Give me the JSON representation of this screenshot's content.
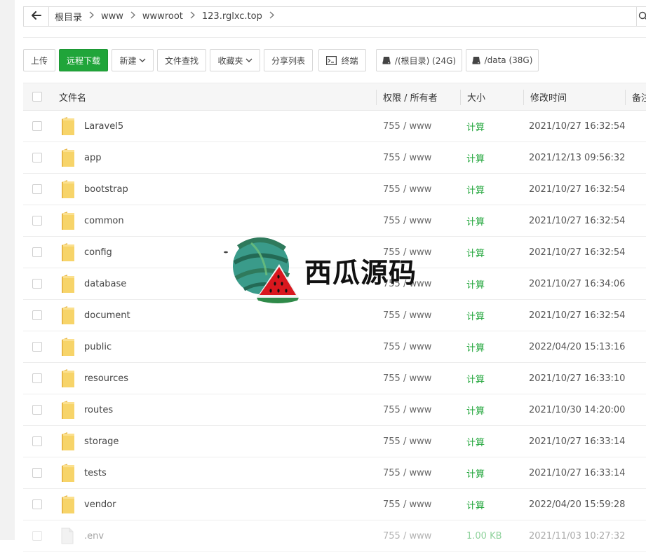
{
  "breadcrumb": {
    "items": [
      "根目录",
      "www",
      "wwwroot",
      "123.rglxc.top"
    ]
  },
  "toolbar": {
    "upload": "上传",
    "remote_download": "远程下载",
    "new": "新建",
    "file_search": "文件查找",
    "favorites": "收藏夹",
    "share_list": "分享列表",
    "terminal": "终端",
    "disk_root": "/(根目录) (24G)",
    "disk_data": "/data (38G)"
  },
  "table": {
    "headers": {
      "name": "文件名",
      "perm": "权限 / 所有者",
      "size": "大小",
      "mtime": "修改时间",
      "note": "备注"
    },
    "rows": [
      {
        "name": "Laravel5",
        "perm": "755 / www",
        "size": "计算",
        "mtime": "2021/10/27 16:32:54",
        "type": "folder"
      },
      {
        "name": "app",
        "perm": "755 / www",
        "size": "计算",
        "mtime": "2021/12/13 09:56:32",
        "type": "folder"
      },
      {
        "name": "bootstrap",
        "perm": "755 / www",
        "size": "计算",
        "mtime": "2021/10/27 16:32:54",
        "type": "folder"
      },
      {
        "name": "common",
        "perm": "755 / www",
        "size": "计算",
        "mtime": "2021/10/27 16:32:54",
        "type": "folder"
      },
      {
        "name": "config",
        "perm": "755 / www",
        "size": "计算",
        "mtime": "2021/10/27 16:32:54",
        "type": "folder"
      },
      {
        "name": "database",
        "perm": "755 / www",
        "size": "计算",
        "mtime": "2021/10/27 16:34:06",
        "type": "folder"
      },
      {
        "name": "document",
        "perm": "755 / www",
        "size": "计算",
        "mtime": "2021/10/27 16:32:54",
        "type": "folder"
      },
      {
        "name": "public",
        "perm": "755 / www",
        "size": "计算",
        "mtime": "2022/04/20 15:13:16",
        "type": "folder"
      },
      {
        "name": "resources",
        "perm": "755 / www",
        "size": "计算",
        "mtime": "2021/10/27 16:33:10",
        "type": "folder"
      },
      {
        "name": "routes",
        "perm": "755 / www",
        "size": "计算",
        "mtime": "2021/10/30 14:20:00",
        "type": "folder"
      },
      {
        "name": "storage",
        "perm": "755 / www",
        "size": "计算",
        "mtime": "2021/10/27 16:33:14",
        "type": "folder"
      },
      {
        "name": "tests",
        "perm": "755 / www",
        "size": "计算",
        "mtime": "2021/10/27 16:33:14",
        "type": "folder"
      },
      {
        "name": "vendor",
        "perm": "755 / www",
        "size": "计算",
        "mtime": "2022/04/20 15:59:28",
        "type": "folder"
      },
      {
        "name": ".env",
        "perm": "755 / www",
        "size": "1.00 KB",
        "mtime": "2021/11/03 10:27:32",
        "type": "file"
      }
    ]
  },
  "watermark": {
    "text": "西瓜源码"
  },
  "colors": {
    "accent_green": "#20a53a",
    "folder_yellow": "#f7d469",
    "header_bg": "#f6f6f6"
  },
  "icons": {
    "back": "arrow-left-icon",
    "search": "search-icon",
    "terminal": "terminal-icon",
    "disk": "disk-icon",
    "folder": "folder-icon",
    "file": "file-icon",
    "chevron": "chevron-down-icon"
  }
}
